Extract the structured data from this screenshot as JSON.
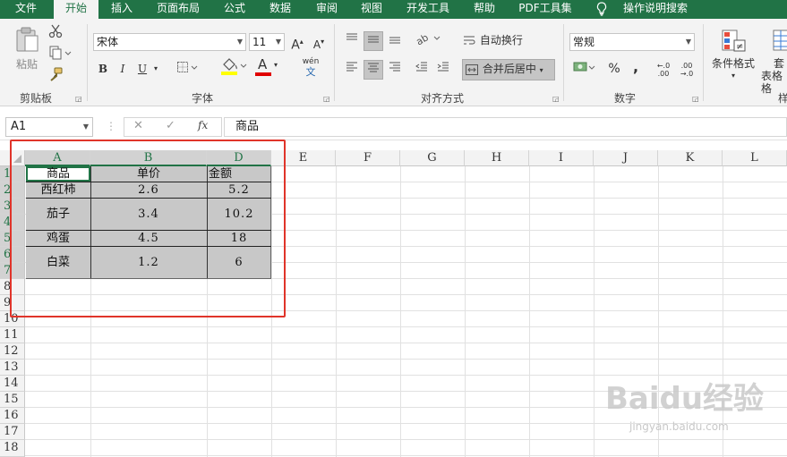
{
  "menu": {
    "tabs": [
      "文件",
      "开始",
      "插入",
      "页面布局",
      "公式",
      "数据",
      "审阅",
      "视图",
      "开发工具",
      "帮助",
      "PDF工具集"
    ],
    "search_icon": "lightbulb-icon",
    "search_label": "操作说明搜索"
  },
  "ribbon": {
    "clipboard": {
      "paste_label": "粘贴",
      "group_label": "剪贴板"
    },
    "font": {
      "font_name": "宋体",
      "font_size": "11",
      "bold": "B",
      "italic": "I",
      "underline": "U",
      "grow": "A",
      "shrink": "A",
      "font_color_letter": "A",
      "phonetic": "wén",
      "phonetic_sub": "文",
      "group_label": "字体",
      "fill_color": "#ffff00",
      "text_color": "#e00000"
    },
    "alignment": {
      "wrap_label": "自动换行",
      "merge_label": "合并后居中",
      "group_label": "对齐方式"
    },
    "number": {
      "format": "常规",
      "percent": "%",
      "comma": ",",
      "inc_decimal": "←.0 .00",
      "dec_decimal": ".00 →.0",
      "group_label": "数字"
    },
    "styles": {
      "conditional_label": "条件格式",
      "table_label_1": "套",
      "table_label_2": "表格格"
    }
  },
  "formula_bar": {
    "name_box": "A1",
    "cancel": "✕",
    "enter": "✓",
    "fx": "fx",
    "content": "商品"
  },
  "grid": {
    "columns": [
      "A",
      "B",
      "D",
      "E",
      "F",
      "G",
      "H",
      "I",
      "J",
      "K",
      "L"
    ],
    "rows": [
      "1",
      "2",
      "3",
      "4",
      "5",
      "6",
      "7",
      "8",
      "9",
      "10",
      "11",
      "12",
      "13",
      "14",
      "15",
      "16",
      "17",
      "18"
    ],
    "cells": {
      "a1": "商品",
      "b1": "单价",
      "d1": "金额",
      "a2": "西红柿",
      "b2": "2.6",
      "d2": "5.2",
      "a3": "茄子",
      "b3": "3.4",
      "d3": "10.2",
      "a5": "鸡蛋",
      "b5": "4.5",
      "d5": "18",
      "a6": "白菜",
      "b6": "1.2",
      "d6": "6"
    }
  },
  "watermark": {
    "main": "Baidu经验",
    "sub": "jingyan.baidu.com"
  },
  "colors": {
    "accent": "#217346",
    "highlight_box": "#e0342a",
    "shaded_cells": "#c8c8c8"
  }
}
